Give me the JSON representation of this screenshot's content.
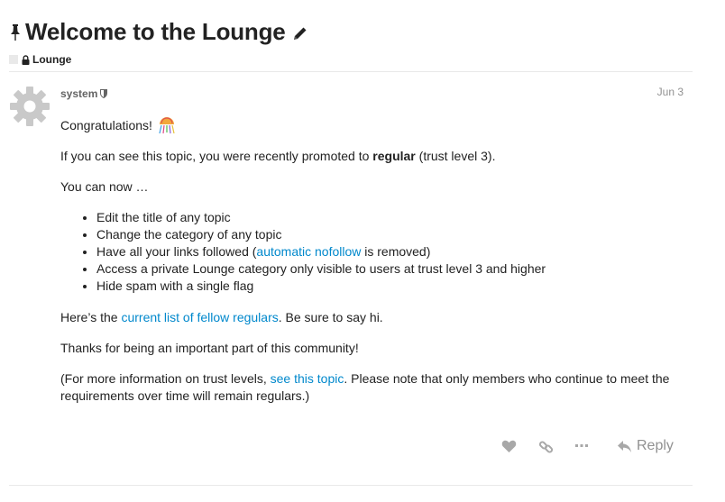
{
  "topic": {
    "title": "Welcome to the Lounge",
    "category": "Lounge"
  },
  "post": {
    "username": "system",
    "date": "Jun 3",
    "congrats": "Congratulations!",
    "promo_before": "If you can see this topic, you were recently promoted to ",
    "promo_bold": "regular",
    "promo_after": " (trust level 3).",
    "can_now": "You can now …",
    "list": {
      "item1": "Edit the title of any topic",
      "item2": "Change the category of any topic",
      "item3_before": "Have all your links followed (",
      "item3_link": "automatic nofollow",
      "item3_after": " is removed)",
      "item4": "Access a private Lounge category only visible to users at trust level 3 and higher",
      "item5": "Hide spam with a single flag"
    },
    "regulars_before": "Here’s the ",
    "regulars_link": "current list of fellow regulars",
    "regulars_after": ". Be sure to say hi.",
    "thanks": "Thanks for being an important part of this community!",
    "info_before": "(For more information on trust levels, ",
    "info_link": "see this topic",
    "info_after": ". Please note that only members who continue to meet the requirements over time will remain regulars.)"
  },
  "actions": {
    "reply_label": "Reply"
  },
  "icons": {
    "pin": "pin-icon",
    "edit": "pencil-icon",
    "lock": "lock-icon",
    "avatar": "gear-icon",
    "moderator": "shield-icon",
    "emoji": "confetti-ball-icon",
    "like": "heart-icon",
    "share": "link-icon",
    "more": "ellipsis-icon",
    "reply": "reply-arrow-icon"
  },
  "colors": {
    "link": "#0088cc",
    "text": "#222222",
    "muted": "#919191",
    "divider": "#e9e9e9",
    "action_icon": "#a8a8a8",
    "avatar": "#c9c9c9"
  }
}
